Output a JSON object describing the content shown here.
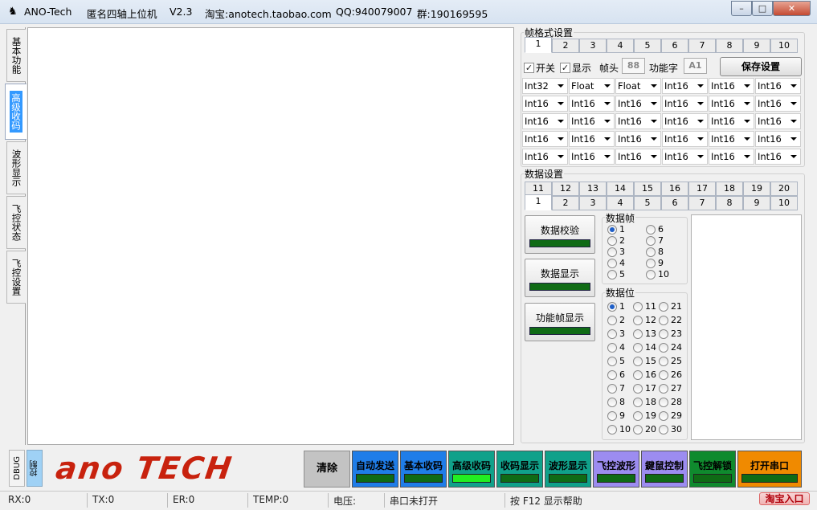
{
  "titlebar": {
    "app": "ANO-Tech",
    "name": "匿名四轴上位机",
    "version": "V2.3",
    "shop": "淘宝:anotech.taobao.com",
    "qq": "QQ:940079007",
    "group": "群:190169595"
  },
  "window_buttons": {
    "minimize": "–",
    "maximize": "□",
    "close": "✕"
  },
  "left_tabs": [
    "基本功能",
    "高级收码",
    "波形显示",
    "飞控状态",
    "飞控设置"
  ],
  "frame_format": {
    "group_label": "帧格式设置",
    "tabs": [
      "1",
      "2",
      "3",
      "4",
      "5",
      "6",
      "7",
      "8",
      "9",
      "10"
    ],
    "active_tab": "1",
    "switch_label": "开关",
    "show_label": "显示",
    "header_label": "帧头",
    "header_value": "88",
    "func_label": "功能字",
    "func_value": "A1",
    "save_button": "保存设置",
    "types": [
      [
        "Int32",
        "Float",
        "Float",
        "Int16",
        "Int16",
        "Int16"
      ],
      [
        "Int16",
        "Int16",
        "Int16",
        "Int16",
        "Int16",
        "Int16"
      ],
      [
        "Int16",
        "Int16",
        "Int16",
        "Int16",
        "Int16",
        "Int16"
      ],
      [
        "Int16",
        "Int16",
        "Int16",
        "Int16",
        "Int16",
        "Int16"
      ],
      [
        "Int16",
        "Int16",
        "Int16",
        "Int16",
        "Int16",
        "Int16"
      ]
    ]
  },
  "data_settings": {
    "group_label": "数据设置",
    "tabs_row1": [
      "11",
      "12",
      "13",
      "14",
      "15",
      "16",
      "17",
      "18",
      "19",
      "20"
    ],
    "tabs_row2": [
      "1",
      "2",
      "3",
      "4",
      "5",
      "6",
      "7",
      "8",
      "9",
      "10"
    ],
    "active_tab": "1",
    "btn_check": "数据校验",
    "btn_show": "数据显示",
    "btn_func_show": "功能帧显示",
    "frame_label": "数据帧",
    "frame_options": [
      "1",
      "2",
      "3",
      "4",
      "5",
      "6",
      "7",
      "8",
      "9",
      "10"
    ],
    "frame_selected": "1",
    "bit_label": "数据位",
    "bit_options": [
      "1",
      "2",
      "3",
      "4",
      "5",
      "6",
      "7",
      "8",
      "9",
      "10",
      "11",
      "12",
      "13",
      "14",
      "15",
      "16",
      "17",
      "18",
      "19",
      "20",
      "21",
      "22",
      "23",
      "24",
      "25",
      "26",
      "27",
      "28",
      "29",
      "30"
    ],
    "bit_selected": "1"
  },
  "bottom": {
    "dbug": "DBUG",
    "ctrl": "控制",
    "logo": "ano TECH",
    "clear": "清除",
    "buttons": [
      {
        "label": "自动发送",
        "bg": "#1f7de8",
        "bar": "#0f6b15"
      },
      {
        "label": "基本收码",
        "bg": "#1f7de8",
        "bar": "#0f6b15"
      },
      {
        "label": "高级收码",
        "bg": "#10a18a",
        "bar": "#22ee22"
      },
      {
        "label": "收码显示",
        "bg": "#10a18a",
        "bar": "#0f6b15"
      },
      {
        "label": "波形显示",
        "bg": "#10a18a",
        "bar": "#0f6b15"
      },
      {
        "label": "飞控波形",
        "bg": "#9c8cf0",
        "bar": "#0f6b15"
      },
      {
        "label": "鍵鼠控制",
        "bg": "#9c8cf0",
        "bar": "#0f6b15"
      },
      {
        "label": "飞控解锁",
        "bg": "#0f8a2e",
        "bar": "#0f6b15"
      },
      {
        "label": "打开串口",
        "bg": "#f08a00",
        "bar": "#0f6b15"
      }
    ]
  },
  "status": {
    "rx": "RX:0",
    "tx": "TX:0",
    "er": "ER:0",
    "temp": "TEMP:0",
    "voltage": "电压:",
    "port": "串口未打开",
    "help": "按 F12 显示帮助",
    "taobao": "淘宝入口"
  }
}
